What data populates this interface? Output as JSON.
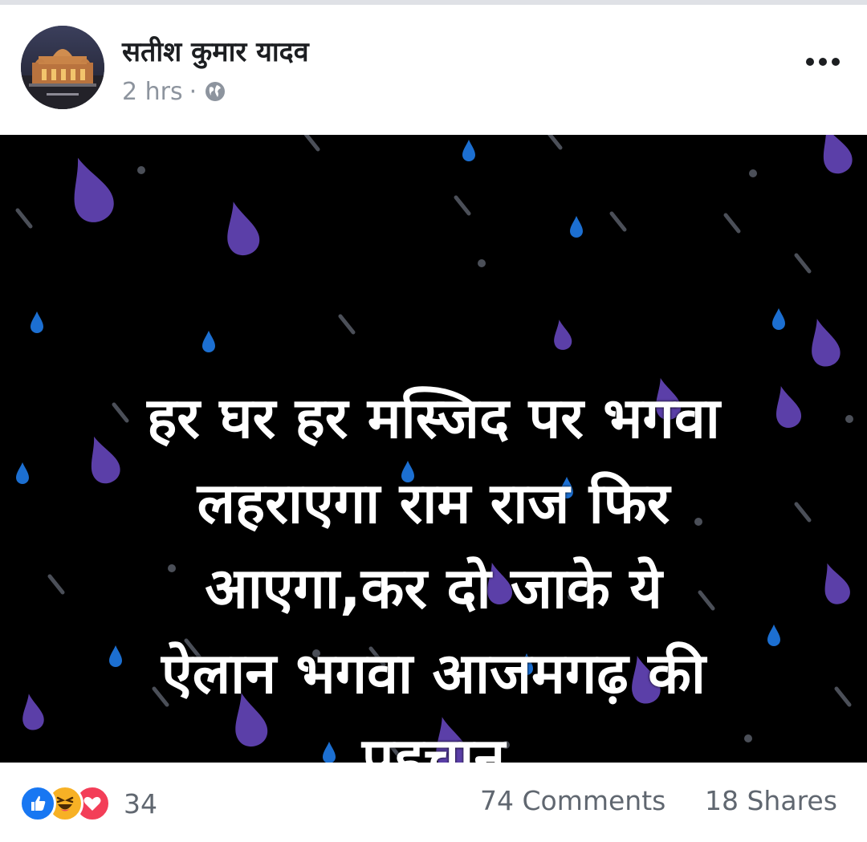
{
  "post": {
    "author": "सतीश कुमार यादव",
    "timestamp": "2 hrs",
    "separator": "·",
    "privacy_icon": "globe-icon",
    "image_text": "हर घर हर मस्जिद पर भगवा\nलहराएगा राम राज फिर\nआएगा,कर दो जाके ये\nऐलान भगवा आजमगढ़ की\nपहचान",
    "image_background": "#000000",
    "text_color": "#ffffff"
  },
  "footer": {
    "reaction_icons": [
      "like-icon",
      "haha-icon",
      "love-icon"
    ],
    "reaction_count": "34",
    "comments": "74 Comments",
    "shares": "18 Shares"
  },
  "colors": {
    "like": "#1877f2",
    "haha": "#f7b125",
    "love": "#f33e58",
    "drop_purple": "#5b3fa8",
    "drop_blue": "#1c6fd1",
    "muted_text": "#606770"
  }
}
